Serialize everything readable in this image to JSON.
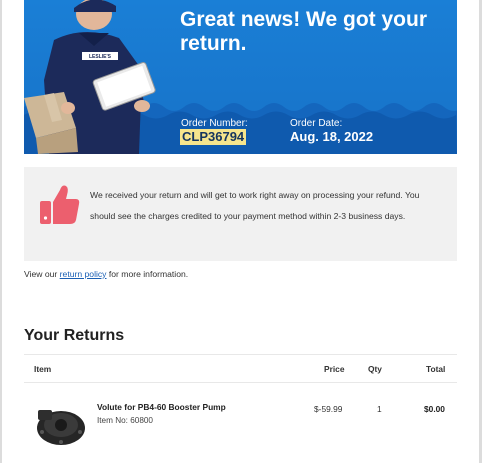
{
  "hero": {
    "title": "Great news! We got your return.",
    "order_number_label": "Order Number:",
    "order_number": "CLP36794",
    "order_date_label": "Order Date:",
    "order_date": "Aug. 18, 2022",
    "shirt_logo": "LESLIE'S"
  },
  "message": {
    "icon": "thumbs-up-icon",
    "text": "We received your return and will get to work right away on processing your refund. You should see the charges credited to your payment method within 2-3 business days."
  },
  "policy": {
    "prefix": "View our ",
    "link": "return policy",
    "suffix": " for more information."
  },
  "returns": {
    "title": "Your Returns",
    "columns": [
      "Item",
      "Price",
      "Qty",
      "Total"
    ],
    "items": [
      {
        "name": "Volute for PB4-60 Booster Pump",
        "sku": "Item No: 60800",
        "price": "$-59.99",
        "qty": "1",
        "total": "$0.00"
      }
    ]
  },
  "colors": {
    "hero_blue": "#1a7fd6",
    "highlight": "#f6e58d",
    "thumb_red": "#ec5f6e",
    "link": "#1a5fb4"
  }
}
